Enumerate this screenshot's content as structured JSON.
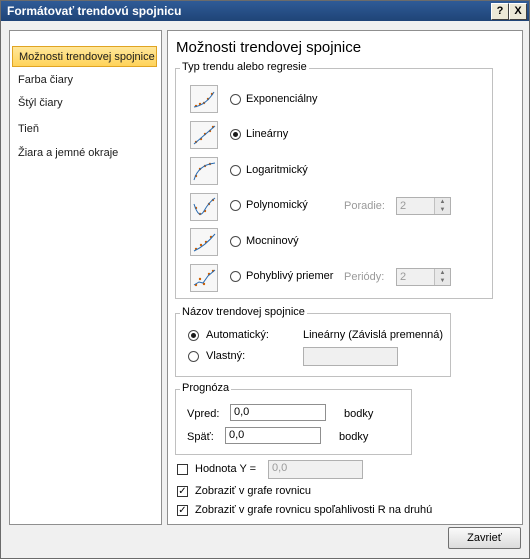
{
  "window": {
    "title": "Formátovať trendovú spojnicu",
    "help_label": "?",
    "close_label": "X"
  },
  "nav": {
    "items": [
      {
        "label": "Možnosti trendovej spojnice",
        "selected": true
      },
      {
        "label": "Farba čiary"
      },
      {
        "label": "Štýl čiary"
      },
      {
        "label": "Tieň"
      },
      {
        "label": "Žiara a jemné okraje"
      }
    ]
  },
  "panel": {
    "title": "Možnosti trendovej spojnice",
    "trend_type": {
      "group_label": "Typ trendu alebo regresie",
      "options": [
        {
          "label": "Exponenciálny",
          "icon": "exponential-trend-icon",
          "selected": false
        },
        {
          "label": "Lineárny",
          "icon": "linear-trend-icon",
          "selected": true
        },
        {
          "label": "Logaritmický",
          "icon": "logarithmic-trend-icon",
          "selected": false
        },
        {
          "label": "Polynomický",
          "icon": "polynomial-trend-icon",
          "selected": false
        },
        {
          "label": "Mocninový",
          "icon": "power-trend-icon",
          "selected": false
        },
        {
          "label": "Pohyblivý priemer",
          "icon": "moving-average-trend-icon",
          "selected": false
        }
      ],
      "order_label": "Poradie:",
      "order_value": "2",
      "period_label": "Periódy:",
      "period_value": "2"
    },
    "trend_name": {
      "group_label": "Názov trendovej spojnice",
      "automatic_label": "Automatický:",
      "automatic_value": "Lineárny (Závislá premenná)",
      "custom_label": "Vlastný:",
      "custom_value": ""
    },
    "forecast": {
      "group_label": "Prognóza",
      "forward_label": "Vpred:",
      "forward_value": "0,0",
      "forward_unit": "bodky",
      "backward_label": "Späť:",
      "backward_value": "0,0",
      "backward_unit": "bodky"
    },
    "intercept": {
      "label": "Hodnota Y =",
      "value": "0,0",
      "checked": false
    },
    "display_equation": {
      "label": "Zobraziť v grafe rovnicu",
      "checked": true
    },
    "display_r_squared": {
      "label": "Zobraziť v grafe rovnicu spoľahlivosti R na druhú",
      "checked": true
    }
  },
  "footer": {
    "close_label": "Zavrieť"
  }
}
